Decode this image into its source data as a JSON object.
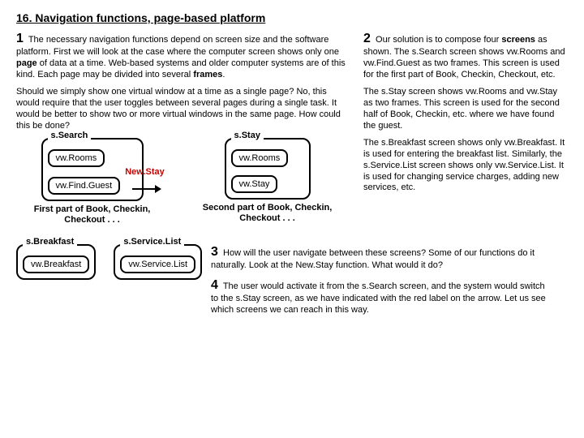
{
  "title": "16. Navigation functions, page-based platform",
  "p1_num": "1",
  "p1_text_a": "The necessary navigation functions depend on screen size and the software platform. First we will look at the case where the computer screen shows only one ",
  "p1_bold_a": "page",
  "p1_text_b": " of data at a time. Web-based systems and older computer systems are of this kind. Each page may be divided into several ",
  "p1_bold_b": "frames",
  "p1_text_c": ".",
  "p1_para2": "Should we simply show one virtual window at a time as a single page? No, this would require that the user toggles between several pages during a single task. It would be better to show two or more virtual windows in the same page. How could this be done?",
  "screens": {
    "search": {
      "label": "s.Search",
      "f1": "vw.Rooms",
      "f2": "vw.Find.Guest"
    },
    "stay": {
      "label": "s.Stay",
      "f1": "vw.Rooms",
      "f2": "vw.Stay"
    },
    "breakfast": {
      "label": "s.Breakfast",
      "f1": "vw.Breakfast"
    },
    "service": {
      "label": "s.Service.List",
      "f1": "vw.Service.List"
    }
  },
  "arrow_label": "New.Stay",
  "caption_left": "First part of Book, Checkin, Checkout . . .",
  "caption_right": "Second part of Book, Checkin, Checkout . . .",
  "p2_num": "2",
  "p2_text_a": "Our solution is to compose four ",
  "p2_bold": "screens",
  "p2_text_b": " as shown. The s.Search screen shows vw.Rooms and vw.Find.Guest as two frames. This screen is used for the first part of Book, Checkin, Checkout, etc.",
  "p2_para2": "The s.Stay screen shows vw.Rooms and vw.Stay as two frames. This screen is used for the second half of Book, Checkin, etc. where we have found the guest.",
  "p2_para3": "The s.Breakfast screen shows only vw.Breakfast. It is used for entering the breakfast list. Similarly, the s.Service.List screen shows only vw.Service.List. It is used for changing service charges, adding new services, etc.",
  "p3_num": "3",
  "p3_text": "How will the user navigate between these screens? Some of our functions do it naturally. Look at the New.Stay function. What would it do?",
  "p4_num": "4",
  "p4_text": "The user would activate it from the s.Search screen, and the system would switch to the s.Stay screen, as we have indicated with the red label on the arrow. Let us see which screens we can reach in this way."
}
